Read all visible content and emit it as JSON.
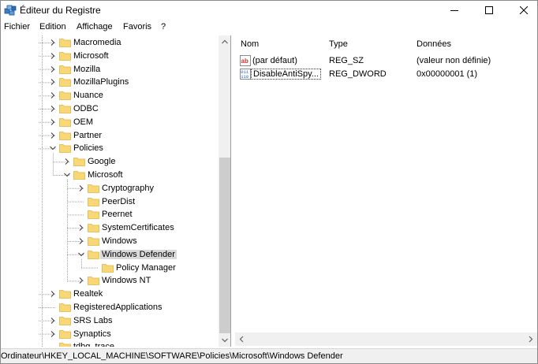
{
  "window": {
    "title": "Éditeur du Registre"
  },
  "menu": [
    "Fichier",
    "Edition",
    "Affichage",
    "Favoris",
    "?"
  ],
  "tree": [
    {
      "label": "Macromedia",
      "expander": "collapsed",
      "level": 0
    },
    {
      "label": "Microsoft",
      "expander": "collapsed",
      "level": 0
    },
    {
      "label": "Mozilla",
      "expander": "collapsed",
      "level": 0
    },
    {
      "label": "MozillaPlugins",
      "expander": "collapsed",
      "level": 0
    },
    {
      "label": "Nuance",
      "expander": "collapsed",
      "level": 0
    },
    {
      "label": "ODBC",
      "expander": "collapsed",
      "level": 0
    },
    {
      "label": "OEM",
      "expander": "collapsed",
      "level": 0
    },
    {
      "label": "Partner",
      "expander": "collapsed",
      "level": 0
    },
    {
      "label": "Policies",
      "expander": "expanded",
      "level": 0
    },
    {
      "label": "Google",
      "expander": "collapsed",
      "level": 1
    },
    {
      "label": "Microsoft",
      "expander": "expanded",
      "level": 1
    },
    {
      "label": "Cryptography",
      "expander": "collapsed",
      "level": 2
    },
    {
      "label": "PeerDist",
      "expander": "none",
      "level": 2
    },
    {
      "label": "Peernet",
      "expander": "none",
      "level": 2
    },
    {
      "label": "SystemCertificates",
      "expander": "collapsed",
      "level": 2
    },
    {
      "label": "Windows",
      "expander": "collapsed",
      "level": 2
    },
    {
      "label": "Windows Defender",
      "expander": "expanded",
      "level": 2,
      "selected": true
    },
    {
      "label": "Policy Manager",
      "expander": "none",
      "level": 3
    },
    {
      "label": "Windows NT",
      "expander": "collapsed",
      "level": 2
    },
    {
      "label": "Realtek",
      "expander": "collapsed",
      "level": 0
    },
    {
      "label": "RegisteredApplications",
      "expander": "none",
      "level": 0
    },
    {
      "label": "SRS Labs",
      "expander": "collapsed",
      "level": 0
    },
    {
      "label": "Synaptics",
      "expander": "collapsed",
      "level": 0
    },
    {
      "label": "tdbg_trace",
      "expander": "none",
      "level": 0
    }
  ],
  "list": {
    "columns": [
      "Nom",
      "Type",
      "Données"
    ],
    "rows": [
      {
        "icon": "string-value-icon",
        "name": "(par défaut)",
        "type": "REG_SZ",
        "data": "(valeur non définie)"
      },
      {
        "icon": "binary-value-icon",
        "name": "DisableAntiSpy...",
        "type": "REG_DWORD",
        "data": "0x00000001 (1)",
        "focused": true
      }
    ]
  },
  "status": {
    "path": "Ordinateur\\HKEY_LOCAL_MACHINE\\SOFTWARE\\Policies\\Microsoft\\Windows Defender"
  },
  "colors": {
    "folder": "#f8d775",
    "folder_dark": "#e1b34a",
    "selection": "#d9d9d9"
  }
}
